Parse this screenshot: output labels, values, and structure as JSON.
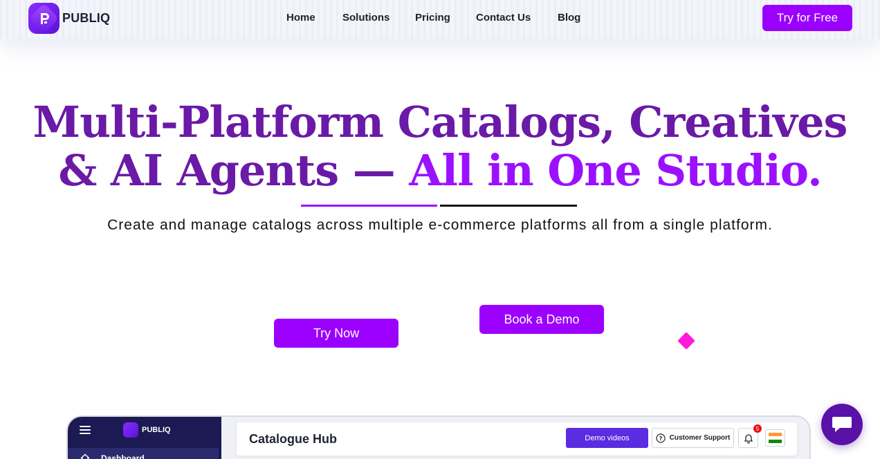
{
  "brand": {
    "name": "PUBLIQ",
    "color": "#9b00ff"
  },
  "nav": {
    "links": [
      "Home",
      "Solutions",
      "Pricing",
      "Contact Us",
      "Blog"
    ],
    "cta": "Try for Free"
  },
  "hero": {
    "title_line1": "Multi-Platform Catalogs, Creatives",
    "title_line2_a": "& AI Agents — ",
    "title_line2_b": "All in One Studio.",
    "subtitle": "Create and manage catalogs across multiple e-commerce platforms all from a single platform.",
    "try_now": "Try Now",
    "book_demo": "Book a Demo"
  },
  "preview": {
    "logo": "PUBLIQ",
    "sidebar_item": "Dashboard",
    "page_title": "Catalogue Hub",
    "demo_videos": "Demo videos",
    "customer_support": "Customer Support",
    "notification_count": "5"
  },
  "icons": {
    "logo": "publiq-logo-icon",
    "chat": "chat-bubble-icon",
    "menu": "hamburger-icon",
    "home": "home-icon",
    "help": "help-circle-icon",
    "bell": "bell-icon",
    "flag": "india-flag-icon"
  }
}
